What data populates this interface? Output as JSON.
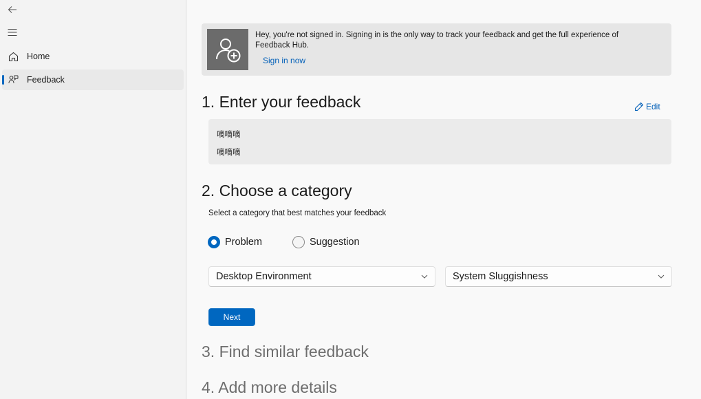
{
  "sidebar": {
    "items": [
      {
        "label": "Home",
        "icon": "home-icon"
      },
      {
        "label": "Feedback",
        "icon": "feedback-icon",
        "selected": true
      }
    ]
  },
  "banner": {
    "message": "Hey, you're not signed in. Signing in is the only way to track your feedback and get the full experience of Feedback Hub.",
    "signin_label": "Sign in now",
    "icon": "person-add-icon"
  },
  "sections": {
    "step1_title": "1. Enter your feedback",
    "edit_label": "Edit",
    "feedback_lines": [
      "嘀嘀嘀",
      "嘀嘀嘀"
    ],
    "step2_title": "2. Choose a category",
    "step2_subtitle": "Select a category that best matches your feedback",
    "step3_title": "3. Find similar feedback",
    "step4_title": "4. Add more details"
  },
  "category": {
    "options": [
      {
        "label": "Problem",
        "selected": true
      },
      {
        "label": "Suggestion",
        "selected": false
      }
    ],
    "dropdown1_value": "Desktop Environment",
    "dropdown2_value": "System Sluggishness",
    "next_label": "Next"
  },
  "colors": {
    "accent": "#0067c0",
    "link": "#005fb8"
  }
}
